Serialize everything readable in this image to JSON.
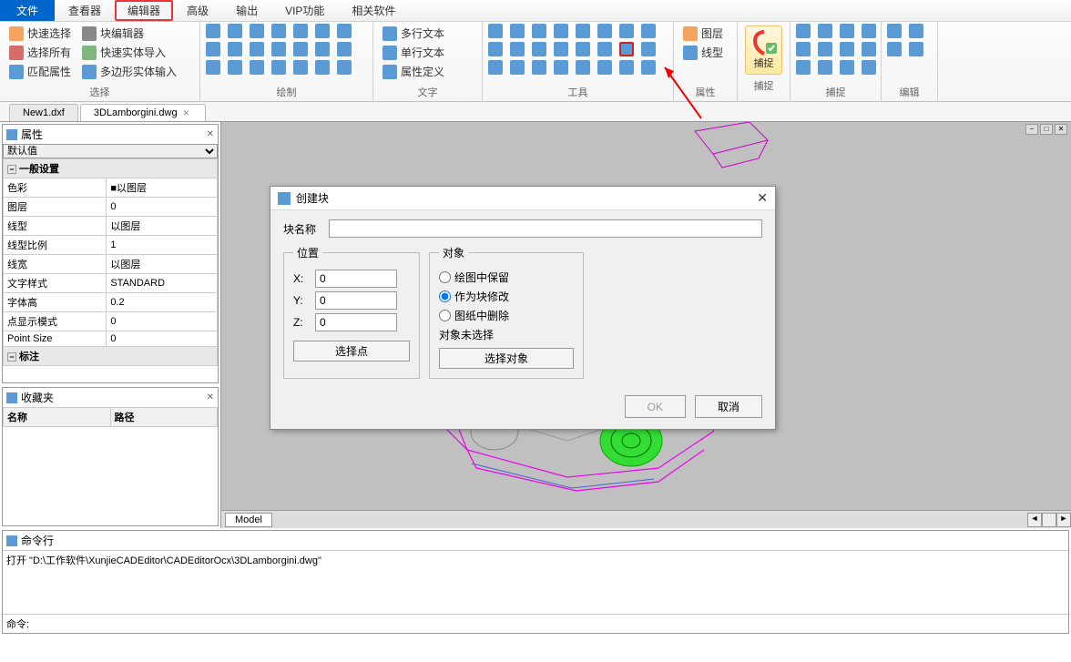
{
  "menu": {
    "file": "文件",
    "tabs": [
      "查看器",
      "编辑器",
      "高级",
      "输出",
      "VIP功能",
      "相关软件"
    ],
    "highlighted_index": 1
  },
  "ribbon": {
    "groups": {
      "select": {
        "label": "选择",
        "quick_select": "快速选择",
        "select_all": "选择所有",
        "match_props": "匹配属性",
        "block_editor": "块编辑器",
        "quick_solid_import": "快速实体导入",
        "poly_solid_input": "多边形实体输入"
      },
      "draw": {
        "label": "绘制"
      },
      "text": {
        "label": "文字",
        "multi_text": "多行文本",
        "single_text": "单行文本",
        "prop_define": "属性定义"
      },
      "tools": {
        "label": "工具"
      },
      "attr": {
        "label": "属性",
        "layer": "图层",
        "linetype": "线型"
      },
      "capture": {
        "label": "捕捉",
        "button": "捕捉"
      },
      "capture2": {
        "label": "捕捉"
      },
      "edit": {
        "label": "编辑"
      }
    }
  },
  "doc_tabs": [
    {
      "label": "New1.dxf",
      "active": false
    },
    {
      "label": "3DLamborgini.dwg",
      "active": true
    }
  ],
  "panels": {
    "properties": {
      "title": "属性",
      "default_value": "默认值",
      "section_general": "一般设置",
      "rows": [
        {
          "k": "色彩",
          "v": "■以图层"
        },
        {
          "k": "图层",
          "v": "0"
        },
        {
          "k": "线型",
          "v": "以图层"
        },
        {
          "k": "线型比例",
          "v": "1"
        },
        {
          "k": "线宽",
          "v": "以图层"
        },
        {
          "k": "文字样式",
          "v": "STANDARD"
        },
        {
          "k": "字体高",
          "v": "0.2"
        },
        {
          "k": "点显示模式",
          "v": "0"
        },
        {
          "k": "Point Size",
          "v": "0"
        }
      ],
      "section_annotation": "标注"
    },
    "favorites": {
      "title": "收藏夹",
      "col_name": "名称",
      "col_path": "路径"
    }
  },
  "dialog": {
    "title": "创建块",
    "name_label": "块名称",
    "name_value": "",
    "pos_legend": "位置",
    "x": "X:",
    "x_val": "0",
    "y": "Y:",
    "y_val": "0",
    "z": "Z:",
    "z_val": "0",
    "select_point": "选择点",
    "obj_legend": "对象",
    "radio_keep": "绘图中保留",
    "radio_modify": "作为块修改",
    "radio_delete": "图纸中删除",
    "obj_unselected": "对象未选择",
    "select_obj": "选择对象",
    "ok": "OK",
    "cancel": "取消"
  },
  "model_tab": "Model",
  "command": {
    "title": "命令行",
    "history": "打开 \"D:\\工作软件\\XunjieCADEditor\\CADEditorOcx\\3DLamborgini.dwg\"",
    "prompt": "命令:"
  }
}
